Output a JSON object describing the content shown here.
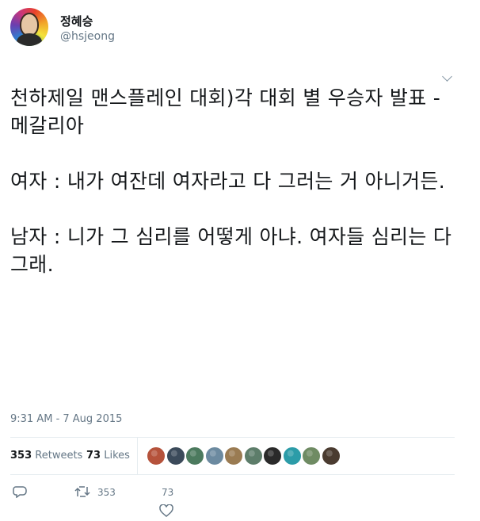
{
  "user": {
    "display_name": "정혜승",
    "handle": "@hsjeong"
  },
  "tweet": {
    "paragraphs": [
      "천하제일 맨스플레인 대회)각 대회 별 우승자 발표 - 메갈리아",
      "여자 : 내가 여잔데 여자라고 다 그러는 거 아니거든.",
      "남자 : 니가 그 심리를 어떻게 아냐. 여자들 심리는 다 그래."
    ],
    "timestamp": "9:31 AM - 7 Aug 2015"
  },
  "stats": {
    "retweets_count": "353",
    "retweets_label": "Retweets",
    "likes_count": "73",
    "likes_label": "Likes"
  },
  "likers": [
    {
      "icon": "liker-avatar",
      "color": "#b5523b"
    },
    {
      "icon": "liker-avatar",
      "color": "#3b4a5a"
    },
    {
      "icon": "liker-avatar",
      "color": "#4c7a5e"
    },
    {
      "icon": "liker-avatar",
      "color": "#6c8aa0"
    },
    {
      "icon": "liker-avatar",
      "color": "#9a7b52"
    },
    {
      "icon": "liker-avatar",
      "color": "#5d7d6a"
    },
    {
      "icon": "liker-avatar",
      "color": "#2a2a2a"
    },
    {
      "icon": "liker-avatar",
      "color": "#2c9ca8"
    },
    {
      "icon": "liker-avatar",
      "color": "#6f8b63"
    },
    {
      "icon": "liker-avatar",
      "color": "#4a3b30"
    }
  ],
  "actions": {
    "reply_icon": "reply-icon",
    "retweet_icon": "retweet-icon",
    "retweet_count": "353",
    "like_icon": "heart-icon",
    "like_count": "73"
  }
}
